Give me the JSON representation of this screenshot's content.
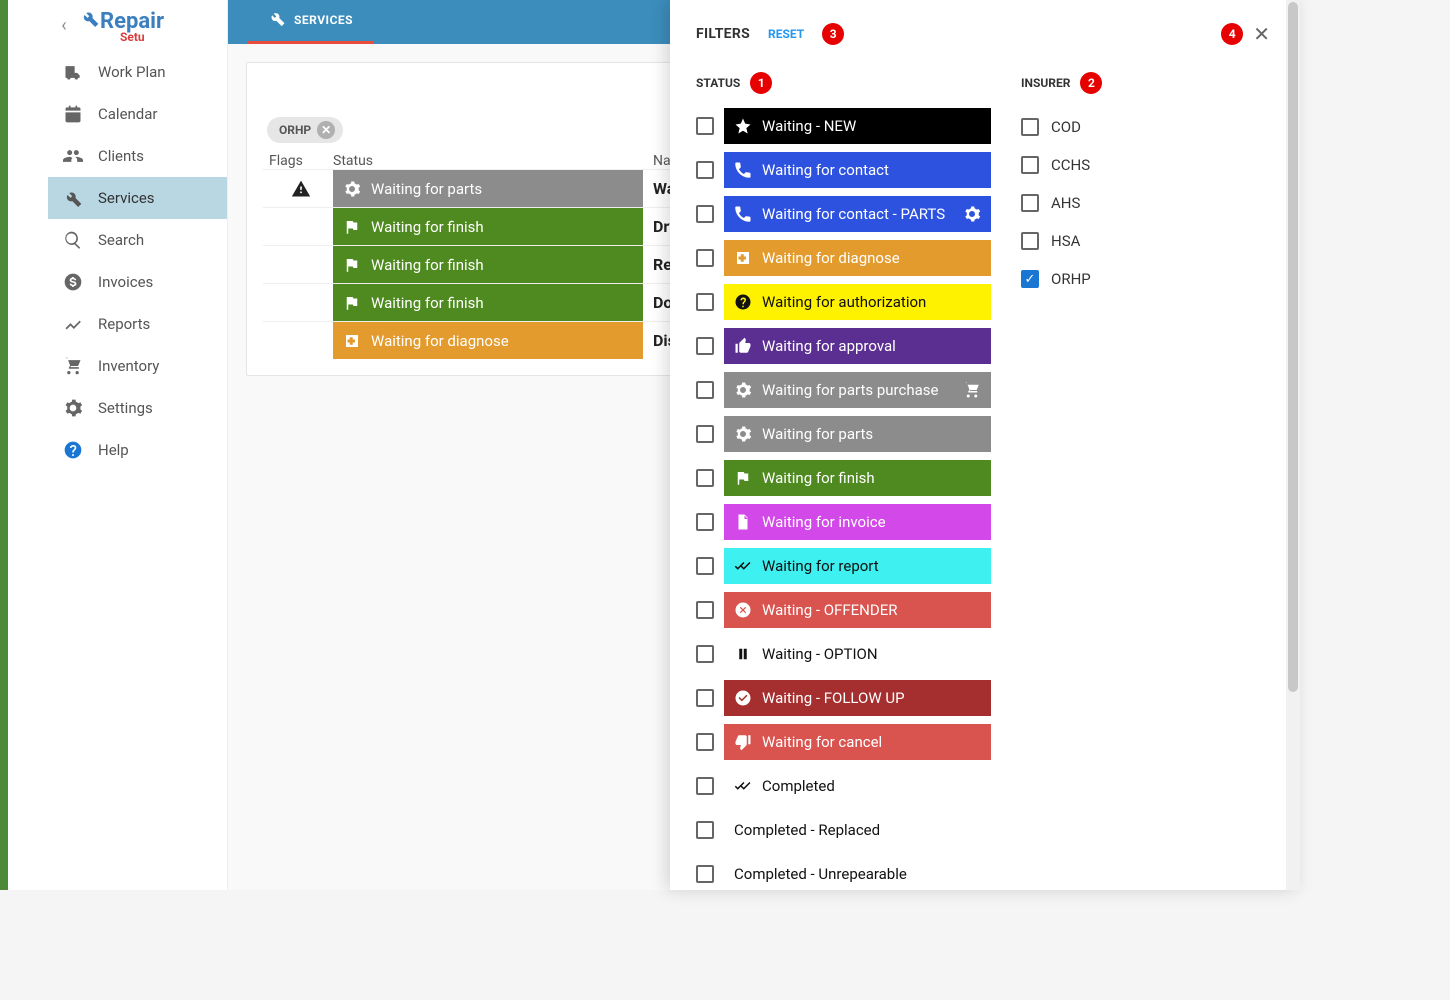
{
  "logo": {
    "rep": "Rep",
    "air": "air",
    "setu": "Setu"
  },
  "sidebar": {
    "items": [
      {
        "label": "Work Plan"
      },
      {
        "label": "Calendar"
      },
      {
        "label": "Clients"
      },
      {
        "label": "Services"
      },
      {
        "label": "Search"
      },
      {
        "label": "Invoices"
      },
      {
        "label": "Reports"
      },
      {
        "label": "Inventory"
      },
      {
        "label": "Settings"
      },
      {
        "label": "Help"
      }
    ]
  },
  "tabs": {
    "services": "SERVICES"
  },
  "chip": {
    "label": "ORHP"
  },
  "grid": {
    "headers": {
      "flags": "Flags",
      "status": "Status",
      "name": "Name"
    },
    "rows": [
      {
        "flag": true,
        "status": "Waiting for parts",
        "color": "#8c8c8c",
        "icon": "gear",
        "name": "Wash"
      },
      {
        "flag": false,
        "status": "Waiting for finish",
        "color": "#4e8a1f",
        "icon": "flag",
        "name": "Dryer"
      },
      {
        "flag": false,
        "status": "Waiting for finish",
        "color": "#4e8a1f",
        "icon": "flag",
        "name": "Refrig"
      },
      {
        "flag": false,
        "status": "Waiting for finish",
        "color": "#4e8a1f",
        "icon": "flag",
        "name": "Doubl"
      },
      {
        "flag": false,
        "status": "Waiting for diagnose",
        "color": "#e49b2e",
        "icon": "medical",
        "name": "Dishw"
      }
    ]
  },
  "filters": {
    "title": "FILTERS",
    "reset": "RESET",
    "status_header": "STATUS",
    "insurer_header": "INSURER",
    "badges": {
      "status": "1",
      "insurer": "2",
      "reset": "3",
      "close": "4"
    },
    "statuses": [
      {
        "label": "Waiting - NEW",
        "bg": "#000000",
        "fg": "#ffffff",
        "icon": "star"
      },
      {
        "label": "Waiting for contact",
        "bg": "#2d52e0",
        "fg": "#ffffff",
        "icon": "phone"
      },
      {
        "label": "Waiting for contact - PARTS",
        "bg": "#2d52e0",
        "fg": "#ffffff",
        "icon": "phone",
        "right_icon": "gear"
      },
      {
        "label": "Waiting for diagnose",
        "bg": "#e49b2e",
        "fg": "#ffffff",
        "icon": "medical"
      },
      {
        "label": "Waiting for authorization",
        "bg": "#fff200",
        "fg": "#111111",
        "icon": "question"
      },
      {
        "label": "Waiting for approval",
        "bg": "#5b2e91",
        "fg": "#ffffff",
        "icon": "thumb-up"
      },
      {
        "label": "Waiting for parts purchase",
        "bg": "#8c8c8c",
        "fg": "#ffffff",
        "icon": "gear",
        "right_icon": "cart"
      },
      {
        "label": "Waiting for parts",
        "bg": "#8c8c8c",
        "fg": "#ffffff",
        "icon": "gear"
      },
      {
        "label": "Waiting for finish",
        "bg": "#4e8a1f",
        "fg": "#ffffff",
        "icon": "flag"
      },
      {
        "label": "Waiting for invoice",
        "bg": "#d348e8",
        "fg": "#ffffff",
        "icon": "doc"
      },
      {
        "label": "Waiting for report",
        "bg": "#3ef0ef",
        "fg": "#111111",
        "icon": "doublecheck"
      },
      {
        "label": "Waiting - OFFENDER",
        "bg": "#d9534f",
        "fg": "#ffffff",
        "icon": "cancel"
      },
      {
        "label": "Waiting - OPTION",
        "bg": "#ffffff",
        "fg": "#111111",
        "icon": "pause",
        "plain": true
      },
      {
        "label": "Waiting - FOLLOW UP",
        "bg": "#a52f2f",
        "fg": "#ffffff",
        "icon": "check-circle"
      },
      {
        "label": "Waiting for cancel",
        "bg": "#d9534f",
        "fg": "#ffffff",
        "icon": "thumb-down"
      },
      {
        "label": "Completed",
        "bg": "#ffffff",
        "fg": "#111111",
        "icon": "doublecheck-solid",
        "plain": true
      },
      {
        "label": "Completed - Replaced",
        "bg": "#ffffff",
        "fg": "#111111",
        "icon": "",
        "plain": true
      },
      {
        "label": "Completed - Unrepearable",
        "bg": "#ffffff",
        "fg": "#111111",
        "icon": "",
        "plain": true
      }
    ],
    "insurers": [
      {
        "label": "COD",
        "checked": false
      },
      {
        "label": "CCHS",
        "checked": false
      },
      {
        "label": "AHS",
        "checked": false
      },
      {
        "label": "HSA",
        "checked": false
      },
      {
        "label": "ORHP",
        "checked": true
      }
    ]
  }
}
